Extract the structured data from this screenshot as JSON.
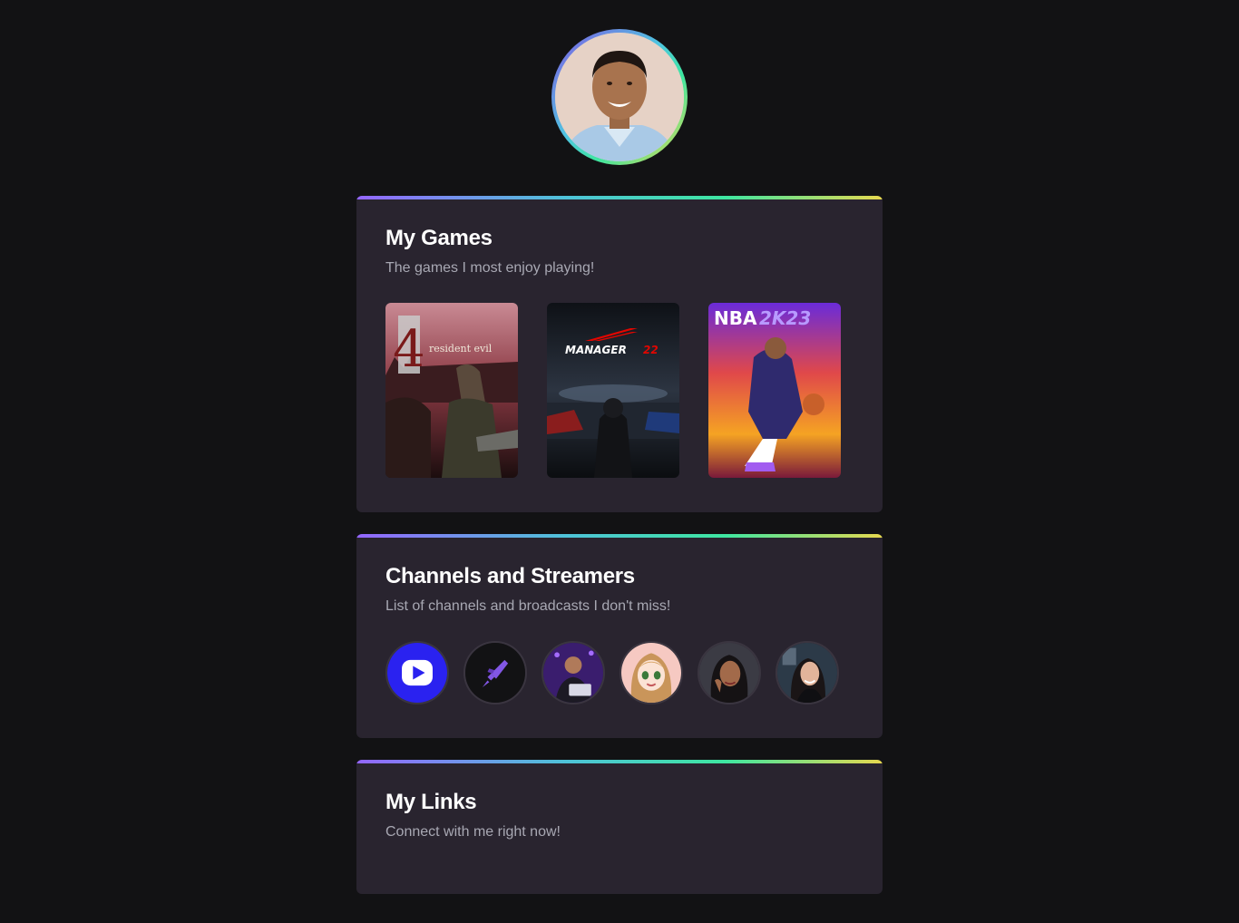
{
  "profile": {
    "avatar_alt": "profile photo"
  },
  "games_section": {
    "title": "My Games",
    "subtitle": "The games I most enjoy playing!",
    "games": [
      {
        "name": "Resident Evil 4",
        "cover_text": "resident evil",
        "cover_number": "4"
      },
      {
        "name": "F1 Manager 22",
        "cover_text": "MANAGER",
        "cover_number": "22"
      },
      {
        "name": "NBA 2K23",
        "cover_text": "NBA",
        "cover_number": "2K23"
      }
    ]
  },
  "channels_section": {
    "title": "Channels and Streamers",
    "subtitle": "List of channels and broadcasts I don't miss!",
    "channels": [
      {
        "icon": "play-icon"
      },
      {
        "icon": "rocket-icon"
      },
      {
        "icon": "streamer-avatar"
      },
      {
        "icon": "cartoon-avatar"
      },
      {
        "icon": "streamer-avatar"
      },
      {
        "icon": "streamer-avatar"
      }
    ]
  },
  "links_section": {
    "title": "My Links",
    "subtitle": "Connect with me right now!"
  },
  "colors": {
    "background": "#121214",
    "card": "#29242f",
    "gradient_start": "#9466ff",
    "gradient_end": "#e6d84f"
  }
}
